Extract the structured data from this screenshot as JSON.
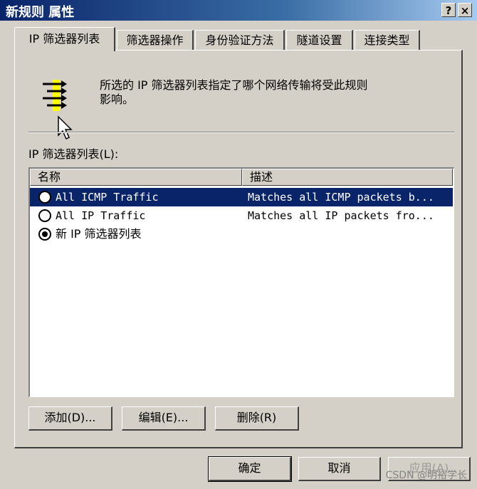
{
  "window": {
    "title": "新规则 属性",
    "help_label": "?",
    "close_label": "×"
  },
  "tabs": [
    {
      "label": "IP 筛选器列表"
    },
    {
      "label": "筛选器操作"
    },
    {
      "label": "身份验证方法"
    },
    {
      "label": "隧道设置"
    },
    {
      "label": "连接类型"
    }
  ],
  "panel": {
    "description_line1": "所选的 IP 筛选器列表指定了哪个网络传输将受此规则",
    "description_line2": "影响。",
    "list_label": "IP 筛选器列表(L):"
  },
  "list": {
    "columns": [
      "名称",
      "描述"
    ],
    "rows": [
      {
        "name": "All ICMP Traffic",
        "description": "Matches all ICMP packets b...",
        "selected_row": true,
        "checked": false
      },
      {
        "name": "All IP Traffic",
        "description": "Matches all IP packets fro...",
        "selected_row": false,
        "checked": false
      },
      {
        "name": "新 IP 筛选器列表",
        "description": "",
        "selected_row": false,
        "checked": true
      }
    ]
  },
  "actions": {
    "add": "添加(D)...",
    "edit": "编辑(E)...",
    "remove": "删除(R)"
  },
  "footer": {
    "ok": "确定",
    "cancel": "取消",
    "apply": "应用(A)"
  },
  "watermark": "CSDN @明裕学长",
  "colors": {
    "title_bar": "#0a246a",
    "selection": "#0a246a",
    "icon_accent": "#ffff00"
  }
}
